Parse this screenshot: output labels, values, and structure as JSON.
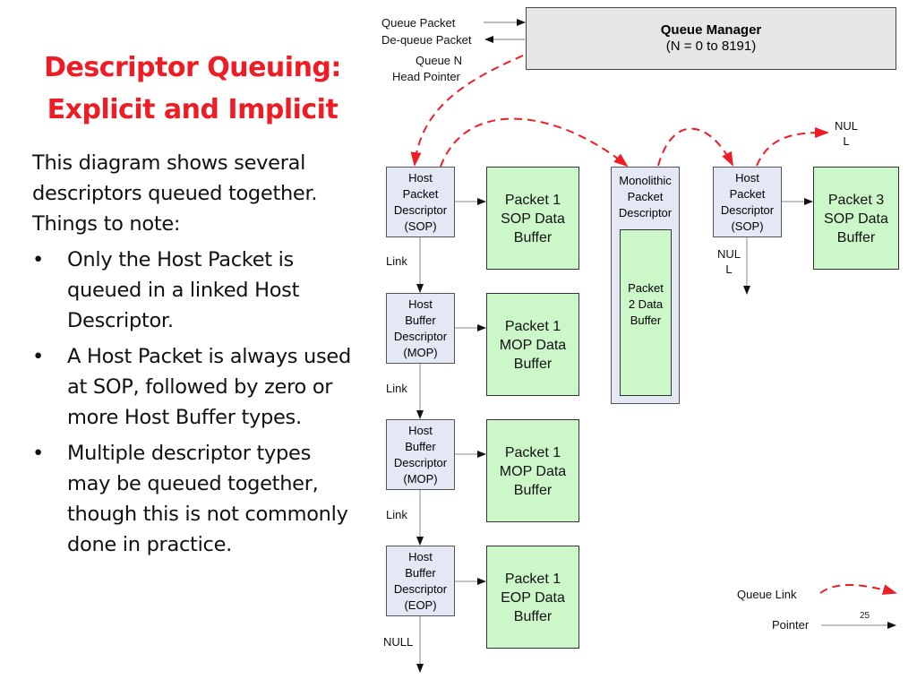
{
  "slide": {
    "title_line1": "Descriptor Queuing:",
    "title_line2": "Explicit and Implicit",
    "intro": "This diagram shows several descriptors queued together. Things to note:",
    "bullets": [
      "Only the Host Packet is queued in a linked Host Descriptor.",
      "A Host Packet is always used at SOP, followed by zero or more Host Buffer types.",
      "Multiple descriptor types may be queued together, though this is not commonly done in practice."
    ],
    "bullet_char": "•",
    "page_number": "25"
  },
  "diagram": {
    "labels": {
      "queue_packet": "Queue Packet",
      "dequeue_packet": "De-queue Packet",
      "queue_n": "Queue N",
      "head_pointer": "Head Pointer",
      "link": "Link",
      "null": "NULL",
      "nul_part1": "NUL",
      "nul_part2": "L"
    },
    "queue_manager": {
      "title": "Queue Manager",
      "range": "(N = 0 to 8191)"
    },
    "descriptors": [
      {
        "lines": [
          "Host",
          "Packet",
          "Descriptor",
          "(SOP)"
        ]
      },
      {
        "lines": [
          "Host",
          "Buffer",
          "Descriptor",
          "(MOP)"
        ]
      },
      {
        "lines": [
          "Host",
          "Buffer",
          "Descriptor",
          "(MOP)"
        ]
      },
      {
        "lines": [
          "Host",
          "Buffer",
          "Descriptor",
          "(EOP)"
        ]
      },
      {
        "lines": [
          "Host",
          "Packet",
          "Descriptor",
          "(SOP)"
        ]
      }
    ],
    "buffers": [
      {
        "lines": [
          "Packet 1",
          "SOP Data",
          "Buffer"
        ]
      },
      {
        "lines": [
          "Packet 1",
          "MOP Data",
          "Buffer"
        ]
      },
      {
        "lines": [
          "Packet 1",
          "MOP Data",
          "Buffer"
        ]
      },
      {
        "lines": [
          "Packet 1",
          "EOP Data",
          "Buffer"
        ]
      },
      {
        "lines": [
          "Packet 3",
          "SOP Data",
          "Buffer"
        ]
      }
    ],
    "monolithic": {
      "lines": [
        "Monolithic",
        "Packet",
        "Descriptor"
      ],
      "buffer_lines": [
        "Packet",
        "2 Data",
        "Buffer"
      ]
    },
    "legend": {
      "queue_link": "Queue Link",
      "pointer": "Pointer"
    },
    "colors": {
      "queue_link": "#ee1c24",
      "descriptor_fill": "#e4e8f4",
      "buffer_fill": "#ccf7c8",
      "manager_fill": "#e6e6e6"
    }
  }
}
